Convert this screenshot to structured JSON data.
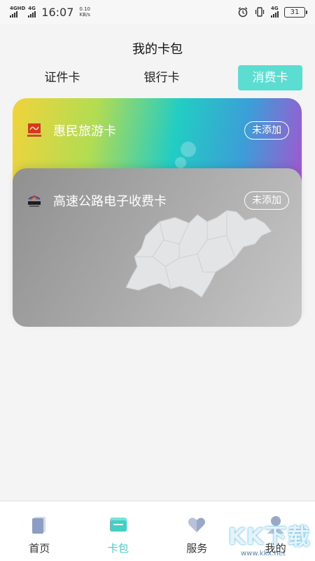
{
  "status_bar": {
    "sim1": "4G",
    "sim1_sup": "HD",
    "sim2": "4G",
    "time": "16:07",
    "net_speed": "0.10",
    "net_unit": "KB/s",
    "right_sim": "4G",
    "battery": "31",
    "icons": [
      "alarm-icon",
      "vibrate-icon",
      "signal-icon",
      "battery-icon"
    ]
  },
  "header": {
    "title": "我的卡包"
  },
  "tabs": [
    {
      "label": "证件卡",
      "active": false
    },
    {
      "label": "银行卡",
      "active": false
    },
    {
      "label": "消费卡",
      "active": true
    }
  ],
  "cards": [
    {
      "name": "惠民旅游卡",
      "status": "未添加",
      "logo": "tour-card-logo"
    },
    {
      "name": "高速公路电子收费卡",
      "status": "未添加",
      "logo": "highway-card-logo"
    }
  ],
  "bottom_nav": [
    {
      "label": "首页",
      "icon": "home-icon",
      "active": false
    },
    {
      "label": "卡包",
      "icon": "wallet-icon",
      "active": true
    },
    {
      "label": "服务",
      "icon": "heart-icon",
      "active": false
    },
    {
      "label": "我的",
      "icon": "profile-icon",
      "active": false
    }
  ],
  "colors": {
    "accent": "#5bddd1",
    "active_nav": "#45cfc4",
    "background": "#f4f4f4"
  }
}
